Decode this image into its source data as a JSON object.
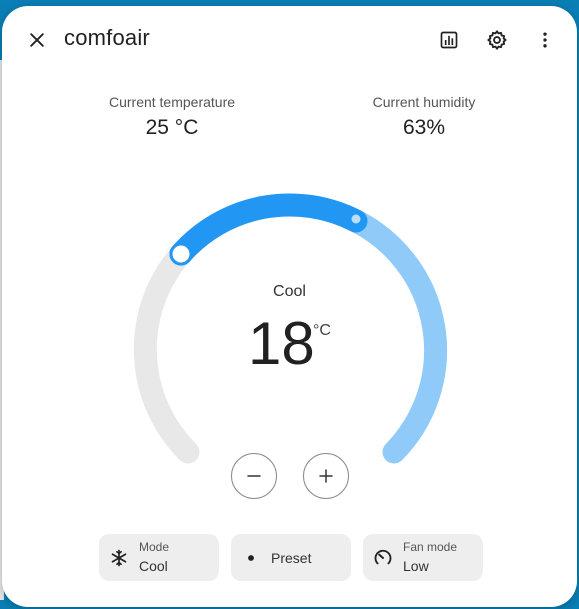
{
  "dialog": {
    "title": "comfoair"
  },
  "icons": {
    "close": "close-icon",
    "history": "history-chart-icon",
    "settings": "gear-icon",
    "menu": "more-vertical-icon"
  },
  "sensors": {
    "temperature": {
      "label": "Current temperature",
      "value": "25 °C"
    },
    "humidity": {
      "label": "Current humidity",
      "value": "63%"
    }
  },
  "thermostat": {
    "mode": "Cool",
    "target": "18",
    "unit": "°C",
    "colors": {
      "track": "#e8e8e8",
      "range": "#90caf9",
      "active": "#2196f3"
    }
  },
  "controls": {
    "decrease_symbol": "−",
    "increase_symbol": "+"
  },
  "chips": [
    {
      "label": "Mode",
      "value": "Cool",
      "icon": "snowflake-icon"
    },
    {
      "label": "",
      "value": "Preset",
      "icon": "dot-icon"
    },
    {
      "label": "Fan mode",
      "value": "Low",
      "icon": "fan-speed-icon"
    }
  ]
}
